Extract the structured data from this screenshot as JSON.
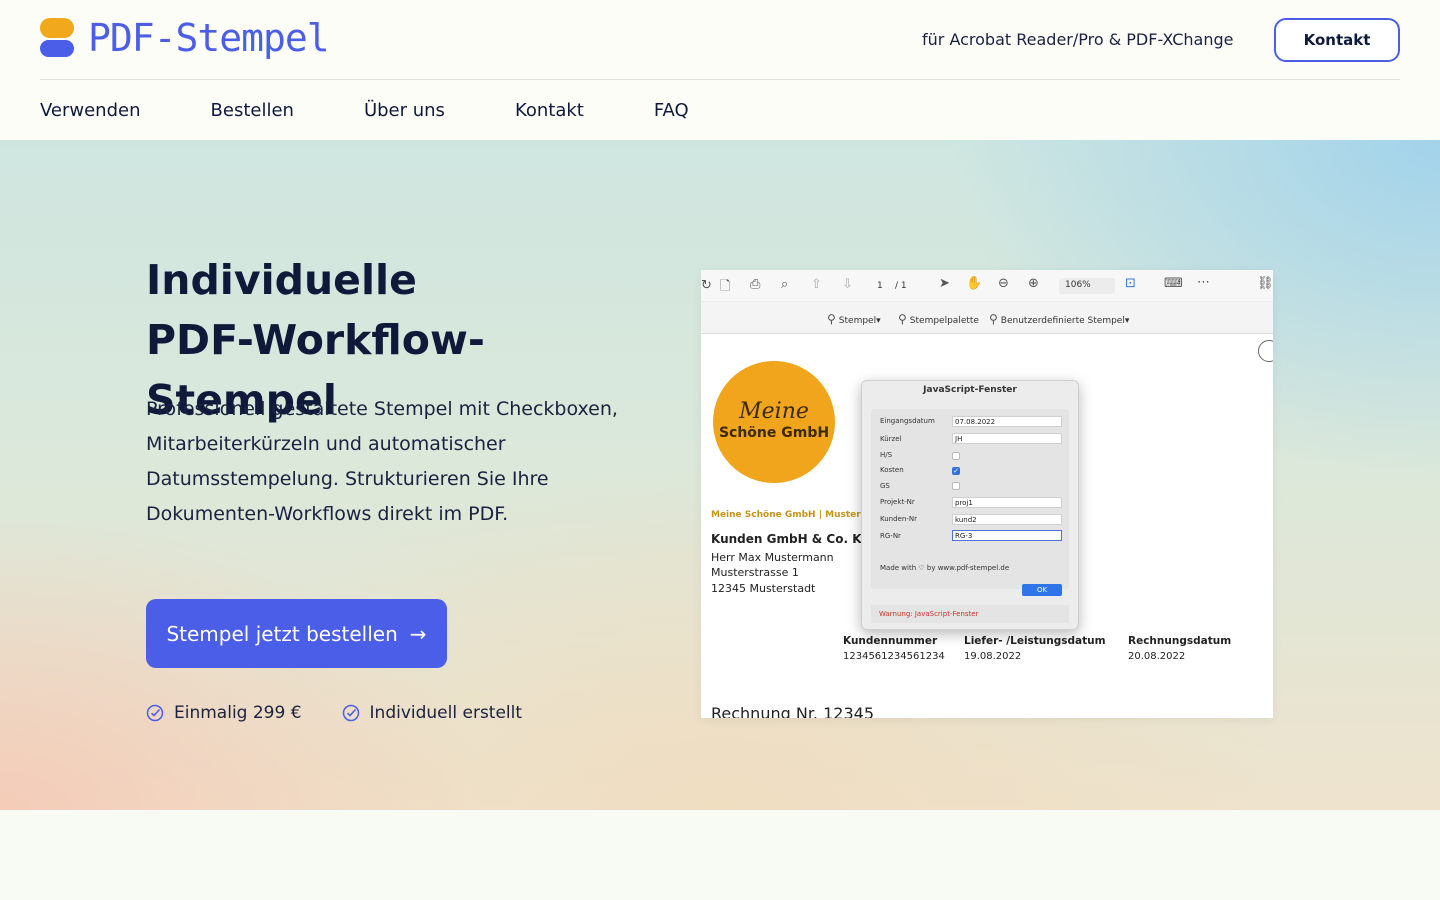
{
  "brand": {
    "name": "PDF-Stempel",
    "primary": "#4a5ee8",
    "accent": "#f2a81c"
  },
  "header": {
    "tagline": "für Acrobat Reader/Pro & PDF-XChange",
    "contact_label": "Kontakt"
  },
  "nav": {
    "items": [
      "Verwenden",
      "Bestellen",
      "Über uns",
      "Kontakt",
      "FAQ"
    ]
  },
  "hero": {
    "title_line1": "Individuelle",
    "title_line2": "PDF-Workflow-Stempel",
    "description": "Professionell gestaltete Stempel mit Checkboxen, Mitarbeiterkürzeln und automatischer Datumsstempelung. Strukturieren Sie Ihre Dokumenten-Workflows direkt im PDF.",
    "cta_label": "Stempel jetzt bestellen",
    "cta_arrow": "→",
    "features": [
      "Einmalig 299 €",
      "Individuell erstellt"
    ]
  },
  "screenshot": {
    "toolbar": {
      "page_current": "1",
      "page_total": "/ 1",
      "zoom": "106%",
      "stamp_menu": "Stempel▾",
      "stamp_palette": "Stempelpalette",
      "custom_stamps": "Benutzerdefinierte Stempel▾"
    },
    "seal": {
      "line1": "Meine",
      "line2": "Schöne GmbH"
    },
    "sender_line": "Meine Schöne GmbH | Musterweg 1",
    "recipient": {
      "company": "Kunden GmbH & Co. KG",
      "name": "Herr Max Mustermann",
      "street": "Musterstrasse 1",
      "city": "12345 Musterstadt"
    },
    "meta": [
      {
        "label": "Kundennummer",
        "value": "1234561234561234"
      },
      {
        "label": "Liefer- /Leistungsdatum",
        "value": "19.08.2022"
      },
      {
        "label": "Rechnungsdatum",
        "value": "20.08.2022"
      }
    ],
    "invoice_title": "Rechnung Nr. 12345",
    "dialog": {
      "title": "JavaScript-Fenster",
      "fields": {
        "eingangsdatum_label": "Eingangsdatum",
        "eingangsdatum_value": "07.08.2022",
        "kuerzel_label": "Kürzel",
        "kuerzel_value": "JH",
        "hs_label": "H/S",
        "kosten_label": "Kosten",
        "gs_label": "GS",
        "projekt_label": "Projekt-Nr",
        "projekt_value": "proj1",
        "kunden_label": "Kunden-Nr",
        "kunden_value": "kund2",
        "rg_label": "RG-Nr",
        "rg_value": "RG-3"
      },
      "made_with": "Made with ♡ by www.pdf-stempel.de",
      "ok_label": "OK",
      "warning": "Warnung: JavaScript-Fenster"
    }
  }
}
